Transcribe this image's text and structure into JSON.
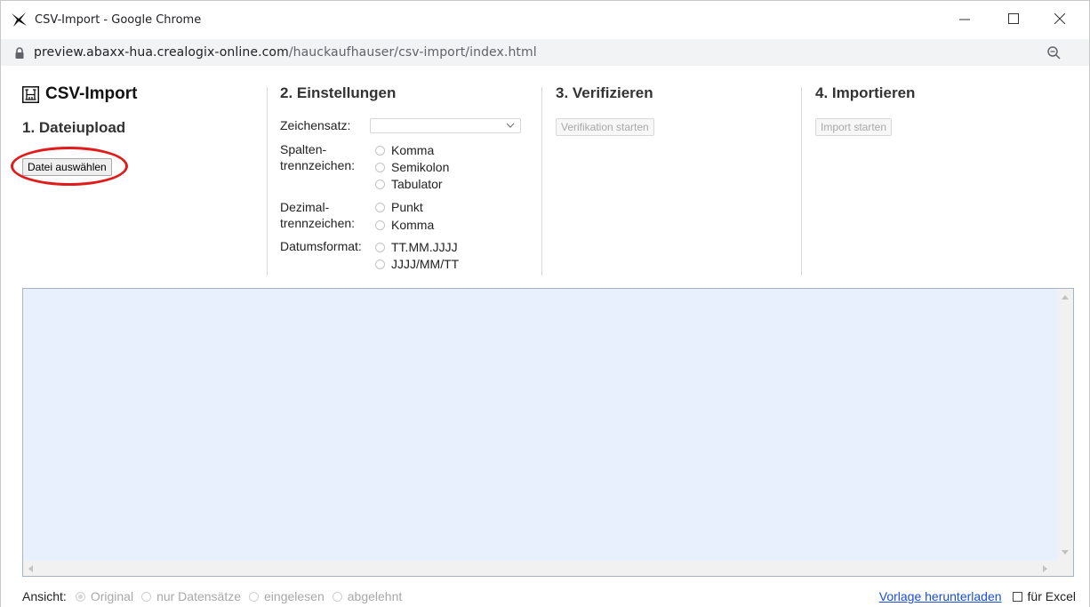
{
  "window": {
    "title": "CSV-Import - Google Chrome",
    "url_host": "preview.abaxx-hua.crealogix-online.com",
    "url_path": "/hauckaufhauser/csv-import/index.html"
  },
  "app": {
    "title": "CSV-Import",
    "logo_icon": "building-logo-icon"
  },
  "step1": {
    "title": "1. Dateiupload",
    "button": "Datei auswählen",
    "highlight_color": "#e01b1b"
  },
  "step2": {
    "title": "2. Einstellungen",
    "charset_label": "Zeichensatz:",
    "charset_value": "",
    "separator_label_1": "Spalten-",
    "separator_label_2": "trennzeichen:",
    "separator_options": [
      "Komma",
      "Semikolon",
      "Tabulator"
    ],
    "decimal_label_1": "Dezimal-",
    "decimal_label_2": "trennzeichen:",
    "decimal_options": [
      "Punkt",
      "Komma"
    ],
    "date_label": "Datumsformat:",
    "date_options": [
      "TT.MM.JJJJ",
      "JJJJ/MM/TT"
    ]
  },
  "step3": {
    "title": "3. Verifizieren",
    "button": "Verifikation starten"
  },
  "step4": {
    "title": "4. Importieren",
    "button": "Import starten"
  },
  "footer": {
    "view_label": "Ansicht:",
    "view_options": [
      "Original",
      "nur Datensätze",
      "eingelesen",
      "abgelehnt"
    ],
    "selected_view": "Original",
    "template_link": "Vorlage herunterladen",
    "excel_checkbox_label": "für Excel"
  },
  "colors": {
    "textarea_bg": "#e8f0fd",
    "link": "#1a4ed8",
    "disabled_text": "#a8a8a8"
  }
}
